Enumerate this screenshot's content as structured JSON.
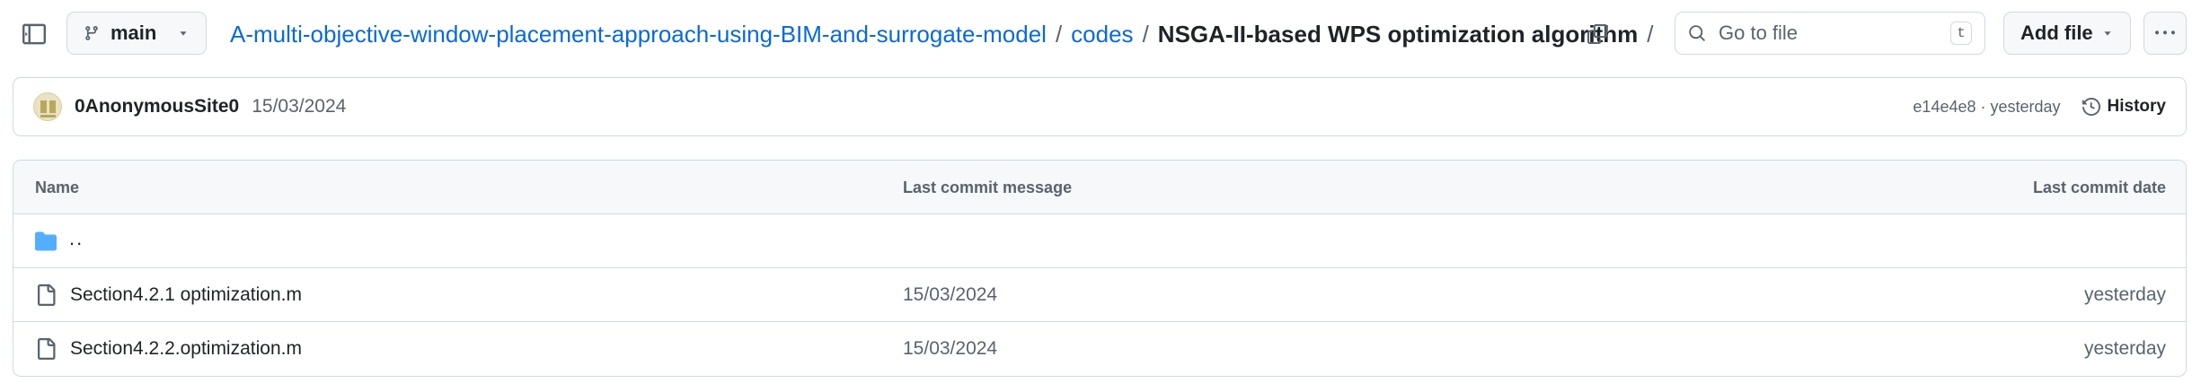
{
  "header": {
    "branch": "main",
    "breadcrumb": {
      "repo": "A-multi-objective-window-placement-approach-using-BIM-and-surrogate-model",
      "folder": "codes",
      "current": "NSGA-II-based WPS optimization algorithm",
      "separator": "/"
    },
    "search": {
      "placeholder": "Go to file",
      "shortcut": "t"
    },
    "add_file_label": "Add file"
  },
  "latest_commit": {
    "author": "0AnonymousSite0",
    "message": "15/03/2024",
    "sha_and_time": "e14e4e8 · yesterday",
    "history_label": "History"
  },
  "file_table": {
    "columns": [
      "Name",
      "Last commit message",
      "Last commit date"
    ],
    "parent_dir": "..",
    "rows": [
      {
        "name": "Section4.2.1 optimization.m",
        "message": "15/03/2024",
        "date": "yesterday"
      },
      {
        "name": "Section4.2.2.optimization.m",
        "message": "15/03/2024",
        "date": "yesterday"
      }
    ]
  },
  "colors": {
    "link": "#0969da",
    "muted": "#59636e",
    "folder": "#54aeff",
    "border": "#d1d9e0",
    "header_bg": "#f6f8fa"
  },
  "icons": [
    "sidebar-icon",
    "branch-icon",
    "chevron-down-icon",
    "copy-icon",
    "search-icon",
    "clock-icon",
    "kebab-icon",
    "folder-icon",
    "file-icon"
  ]
}
